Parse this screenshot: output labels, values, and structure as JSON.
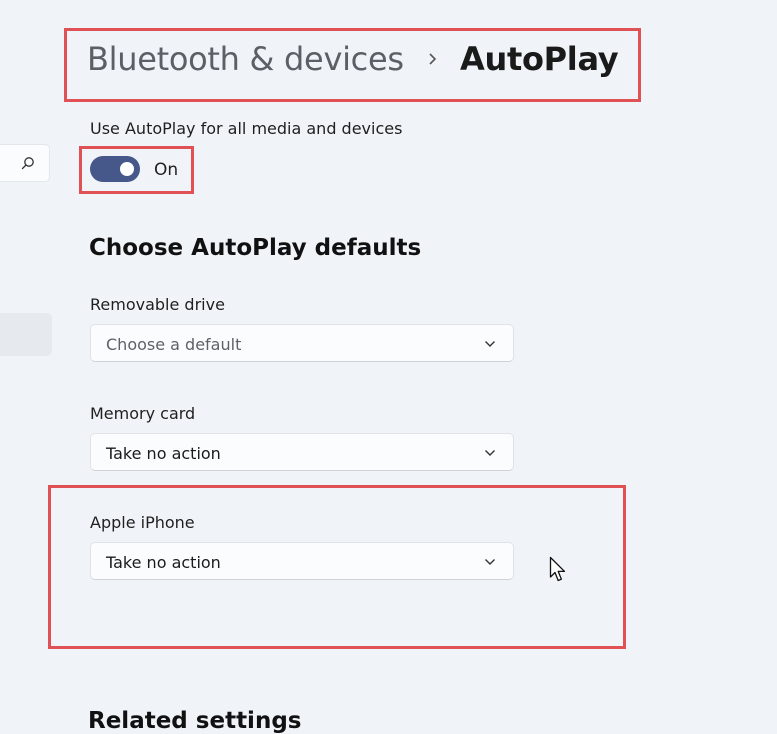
{
  "breadcrumb": {
    "parent": "Bluetooth & devices",
    "current": "AutoPlay"
  },
  "autoplay_toggle": {
    "label": "Use AutoPlay for all media and devices",
    "state": "On",
    "on": true
  },
  "defaults_section": {
    "heading": "Choose AutoPlay defaults",
    "items": [
      {
        "label": "Removable drive",
        "value": "Choose a default"
      },
      {
        "label": "Memory card",
        "value": "Take no action"
      },
      {
        "label": "Apple iPhone",
        "value": "Take no action"
      }
    ]
  },
  "related_section": {
    "heading": "Related settings"
  },
  "icons": {
    "sidebar_search": "search-icon",
    "breadcrumb_separator": "chevron-right-icon",
    "dropdown": "chevron-down-icon",
    "pointer": "mouse-cursor-icon"
  },
  "colors": {
    "background": "#f0f4f9",
    "toggle_on": "#465889",
    "highlight_box": "#e05156"
  }
}
